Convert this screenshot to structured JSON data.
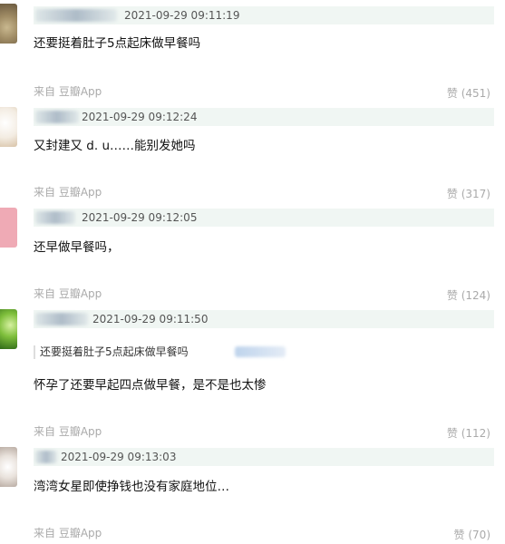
{
  "comments": [
    {
      "time": "2021-09-29 09:11:19",
      "text": "还要挺着肚子5点起床做早餐吗",
      "source": "来自 豆瓣App",
      "likes": "赞 (451)"
    },
    {
      "time": "2021-09-29 09:12:24",
      "text": "又封建又 d. u……能别发她吗",
      "source": "来自 豆瓣App",
      "likes": "赞 (317)"
    },
    {
      "time": "2021-09-29 09:12:05",
      "text": "还早做早餐吗，",
      "source": "来自 豆瓣App",
      "likes": "赞 (124)"
    },
    {
      "time": "2021-09-29 09:11:50",
      "quote": "还要挺着肚子5点起床做早餐吗",
      "text": "怀孕了还要早起四点做早餐，是不是也太惨",
      "source": "来自 豆瓣App",
      "likes": "赞 (112)"
    },
    {
      "time": "2021-09-29 09:13:03",
      "text": "湾湾女星即使挣钱也没有家庭地位…",
      "source": "来自 豆瓣App",
      "likes": "赞 (70)"
    }
  ]
}
